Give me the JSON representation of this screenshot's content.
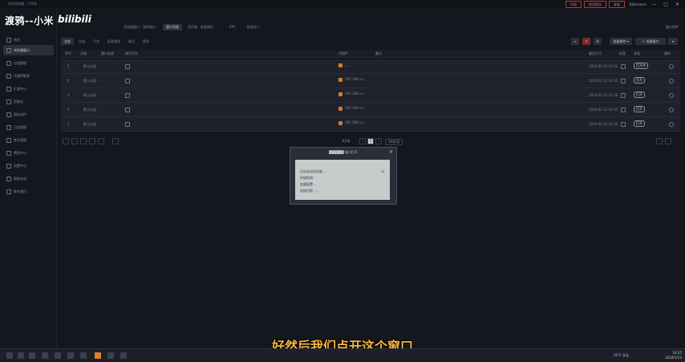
{
  "titlebar": {
    "app_title": "比特浏览器 · 工作台",
    "buttons": [
      "充值",
      "使用教程",
      "客服"
    ],
    "username": "Bitbrowser",
    "controls": [
      "—",
      "□",
      "✕"
    ]
  },
  "watermark": {
    "text": "渡鸦--小米",
    "brand": "bilibili"
  },
  "sidebar": {
    "items": [
      {
        "label": "首页",
        "icon": "home-icon"
      },
      {
        "label": "浏览器窗口",
        "icon": "window-icon",
        "active": true
      },
      {
        "label": "分组管理",
        "icon": "folder-icon"
      },
      {
        "label": "代理IP管理",
        "icon": "globe-icon"
      },
      {
        "label": "扩展中心",
        "icon": "puzzle-icon"
      },
      {
        "label": "回收站",
        "icon": "trash-icon"
      },
      {
        "label": "团队协作",
        "icon": "team-icon"
      },
      {
        "label": "日志管理",
        "icon": "log-icon"
      },
      {
        "label": "账号管理",
        "icon": "user-icon"
      },
      {
        "label": "费用中心",
        "icon": "wallet-icon"
      },
      {
        "label": "设置中心",
        "icon": "gear-icon"
      },
      {
        "label": "帮助文档",
        "icon": "help-icon"
      },
      {
        "label": "联系我们",
        "icon": "phone-icon"
      }
    ]
  },
  "tabs": [
    {
      "label": "浏览器窗口 · 我的窗口"
    },
    {
      "label": "窗口列表",
      "active": true
    },
    {
      "label": "同步器 · 批量操作"
    },
    {
      "label": "RPA"
    },
    {
      "label": "批量导入"
    }
  ],
  "tab_extra": "窗口同步",
  "toolbar": {
    "filters": [
      {
        "label": "全部",
        "active": true
      },
      {
        "label": "分组"
      },
      {
        "label": "平台"
      },
      {
        "label": "标签筛选"
      },
      {
        "label": "备注"
      },
      {
        "label": "更多"
      }
    ],
    "buttons": [
      "≡",
      "⚲",
      "⚙",
      "批量操作 ▾",
      "＋ 创建窗口",
      "▾"
    ]
  },
  "table": {
    "headers": [
      "序号",
      "分组",
      "窗口名称",
      "账号平台",
      "代理IP",
      "备注",
      "最近打开",
      "标签",
      "状态",
      "操作"
    ],
    "rows": [
      {
        "seq": "5",
        "group": "默认分组",
        "proxy": "—",
        "note": "",
        "time": "2024-01-12 14:22",
        "status": "打开中"
      },
      {
        "seq": "4",
        "group": "默认分组",
        "proxy": "192.168.x.x",
        "note": "",
        "time": "2024-01-12 14:20",
        "status": "打开"
      },
      {
        "seq": "3",
        "group": "默认分组",
        "proxy": "192.168.x.x",
        "note": "",
        "time": "2024-01-12 14:18",
        "status": "打开"
      },
      {
        "seq": "2",
        "group": "默认分组",
        "proxy": "192.168.x.x",
        "note": "",
        "time": "2024-01-12 14:15",
        "status": "打开"
      },
      {
        "seq": "1",
        "group": "默认分组",
        "proxy": "192.168.x.x",
        "note": "",
        "time": "2024-01-12 14:10",
        "status": "打开"
      }
    ]
  },
  "pagination": {
    "total": "共5条",
    "page": "1",
    "per_page": "10条/页",
    "prev": "‹",
    "next": "›"
  },
  "dialog": {
    "title": "██████ 窗口打开",
    "lines": [
      "正在启动浏览器 ...",
      "环境检测",
      "加载配置 ...",
      "连接代理 ....."
    ],
    "close": "✕"
  },
  "subtitle": "好然后我们点开这个窗口",
  "taskbar": {
    "weather": "16°C  多云",
    "time": "14:25",
    "date": "2024/1/12"
  },
  "colors": {
    "accent": "#e87d2d",
    "subtitle": "#f6b73c",
    "background": "#15171f"
  }
}
